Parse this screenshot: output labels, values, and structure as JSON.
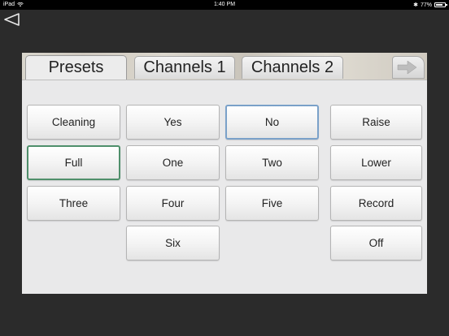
{
  "status_bar": {
    "device": "iPad",
    "time": "1:40 PM",
    "battery_text": "77%",
    "battery_level": 0.77
  },
  "tabs": [
    {
      "label": "Presets"
    },
    {
      "label": "Channels 1"
    },
    {
      "label": "Channels 2"
    }
  ],
  "buttons": {
    "cleaning": "Cleaning",
    "yes": "Yes",
    "no": "No",
    "raise": "Raise",
    "full": "Full",
    "one": "One",
    "two": "Two",
    "lower": "Lower",
    "three": "Three",
    "four": "Four",
    "five": "Five",
    "record": "Record",
    "six": "Six",
    "off": "Off"
  },
  "colors": {
    "selected_blue": "#7aa1c9",
    "selected_green": "#4f8f6b"
  }
}
